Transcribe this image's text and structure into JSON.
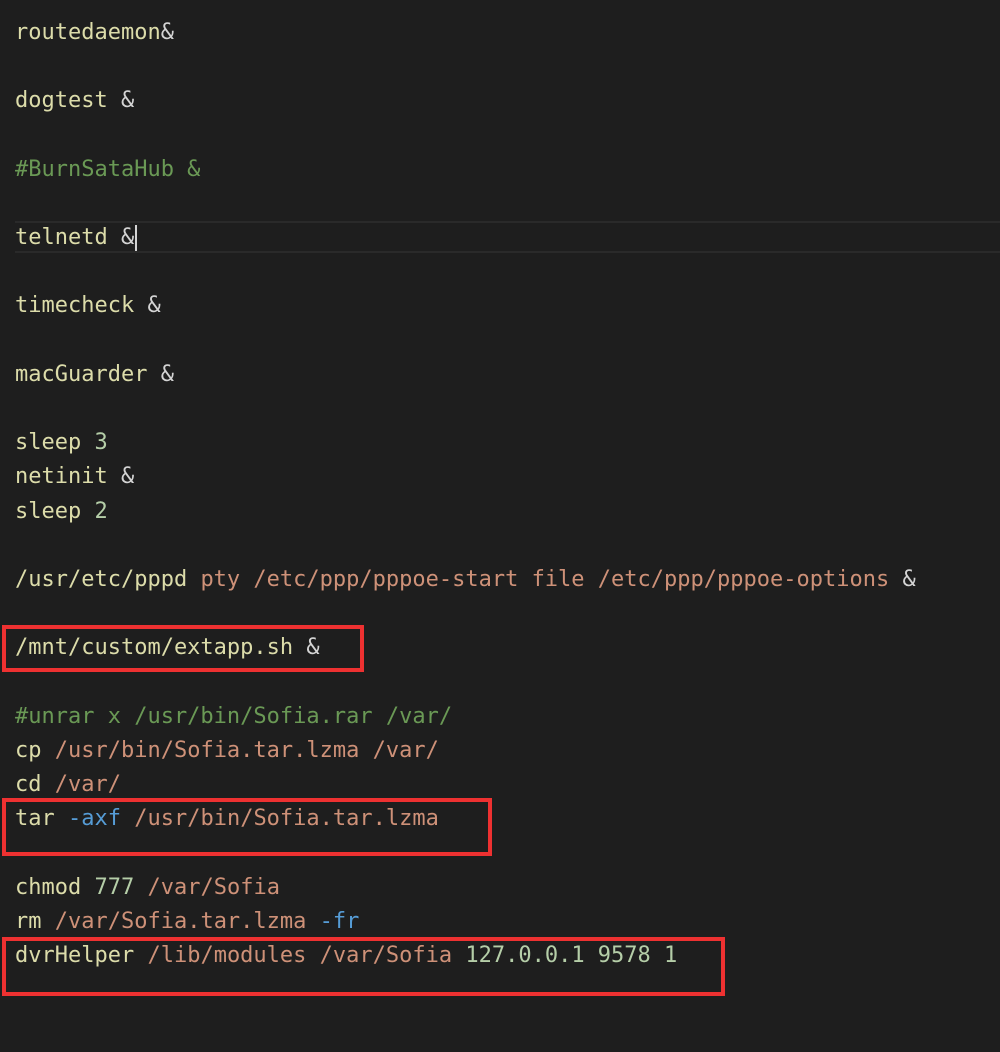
{
  "editor": {
    "lines": {
      "routedaemon": {
        "cmd": "routedaemon",
        "op": "&"
      },
      "dogtest": {
        "cmd": "dogtest",
        "op": "&"
      },
      "burnsatahub": {
        "comment": "#BurnSataHub &"
      },
      "telnetd": {
        "cmd": "telnetd",
        "op": "&"
      },
      "timecheck": {
        "cmd": "timecheck",
        "op": "&"
      },
      "macguarder": {
        "cmd": "macGuarder",
        "op": "&"
      },
      "sleep3": {
        "cmd": "sleep",
        "num": "3"
      },
      "netinit": {
        "cmd": "netinit",
        "op": "&"
      },
      "sleep2": {
        "cmd": "sleep",
        "num": "2"
      },
      "pppd": {
        "cmd": "/usr/etc/pppd",
        "args": "pty /etc/ppp/pppoe-start file /etc/ppp/pppoe-options",
        "op": "&"
      },
      "extapp": {
        "cmd": "/mnt/custom/extapp.sh",
        "op": "&"
      },
      "unrar": {
        "comment": "#unrar x /usr/bin/Sofia.rar /var/"
      },
      "cp": {
        "cmd": "cp",
        "args": "/usr/bin/Sofia.tar.lzma /var/"
      },
      "cd": {
        "cmd": "cd",
        "args": "/var/"
      },
      "tar": {
        "cmd": "tar",
        "flag": "-axf",
        "args": "/usr/bin/Sofia.tar.lzma"
      },
      "chmod": {
        "cmd": "chmod",
        "num": "777",
        "args": "/var/Sofia"
      },
      "rm": {
        "cmd": "rm",
        "args": "/var/Sofia.tar.lzma",
        "flag": "-fr"
      },
      "dvrhelper": {
        "cmd": "dvrHelper",
        "args": "/lib/modules /var/Sofia",
        "nums": "127.0.0.1 9578 1"
      }
    }
  },
  "annotations": {
    "highlight_color": "#ee3131",
    "highlighted_lines": [
      "extapp",
      "tar",
      "dvrhelper"
    ]
  },
  "colors": {
    "background": "#1e1e1e",
    "command": "#dcdcaa",
    "argument": "#ce9178",
    "number": "#b5cea8",
    "flag": "#569cd6",
    "comment": "#6a9955"
  }
}
